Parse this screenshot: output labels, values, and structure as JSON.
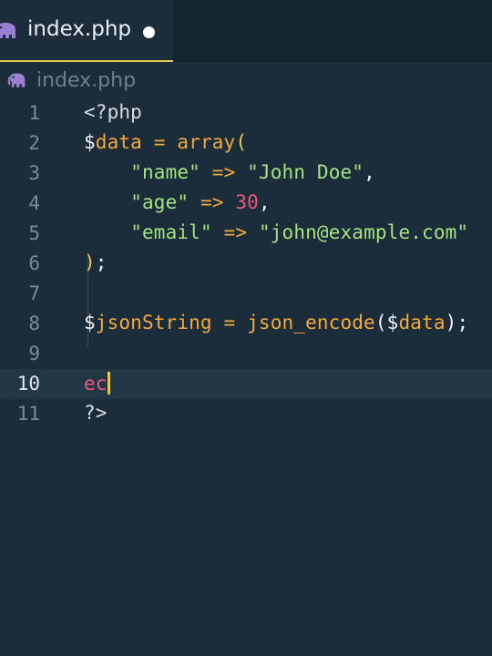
{
  "tab": {
    "label": "index.php",
    "icon": "php-elephant-icon",
    "unsaved": true
  },
  "breadcrumb": {
    "label": "index.php",
    "icon": "php-elephant-icon"
  },
  "colors": {
    "background": "#1b2d3a",
    "tab_bar": "#152530",
    "active_tab_border": "#e6c84f",
    "current_line": "#223746",
    "elephant_icon": "#9b7fd0",
    "string": "#a6e27f",
    "keyword": "#f5a93a",
    "number": "#f0577e"
  },
  "editor": {
    "current_line": 10,
    "lines": [
      {
        "n": "1",
        "tokens": [
          {
            "t": "<?php",
            "c": "tag"
          }
        ]
      },
      {
        "n": "2",
        "tokens": [
          {
            "t": "$",
            "c": "dol"
          },
          {
            "t": "data",
            "c": "var"
          },
          {
            "t": " = ",
            "c": "op"
          },
          {
            "t": "array",
            "c": "fn"
          },
          {
            "t": "(",
            "c": "popen"
          }
        ]
      },
      {
        "n": "3",
        "tokens": [
          {
            "t": "    ",
            "c": "punc"
          },
          {
            "t": "\"name\"",
            "c": "key"
          },
          {
            "t": " => ",
            "c": "op"
          },
          {
            "t": "\"John Doe\"",
            "c": "str"
          },
          {
            "t": ",",
            "c": "punc"
          }
        ]
      },
      {
        "n": "4",
        "tokens": [
          {
            "t": "    ",
            "c": "punc"
          },
          {
            "t": "\"age\"",
            "c": "key"
          },
          {
            "t": " => ",
            "c": "op"
          },
          {
            "t": "30",
            "c": "num"
          },
          {
            "t": ",",
            "c": "punc"
          }
        ]
      },
      {
        "n": "5",
        "tokens": [
          {
            "t": "    ",
            "c": "punc"
          },
          {
            "t": "\"email\"",
            "c": "key"
          },
          {
            "t": " => ",
            "c": "op"
          },
          {
            "t": "\"john@example.com\"",
            "c": "str"
          }
        ]
      },
      {
        "n": "6",
        "tokens": [
          {
            "t": ")",
            "c": "popen"
          },
          {
            "t": ";",
            "c": "punc"
          }
        ]
      },
      {
        "n": "7",
        "tokens": []
      },
      {
        "n": "8",
        "tokens": [
          {
            "t": "$",
            "c": "dol"
          },
          {
            "t": "jsonString",
            "c": "var"
          },
          {
            "t": " = ",
            "c": "op"
          },
          {
            "t": "json_encode",
            "c": "fn"
          },
          {
            "t": "(",
            "c": "paren"
          },
          {
            "t": "$",
            "c": "dol"
          },
          {
            "t": "data",
            "c": "var"
          },
          {
            "t": ")",
            "c": "paren"
          },
          {
            "t": ";",
            "c": "punc"
          }
        ]
      },
      {
        "n": "9",
        "tokens": []
      },
      {
        "n": "10",
        "tokens": [
          {
            "t": "ec",
            "c": "typed"
          }
        ],
        "cursor": true
      },
      {
        "n": "11",
        "tokens": [
          {
            "t": "?>",
            "c": "tag"
          }
        ]
      }
    ]
  }
}
